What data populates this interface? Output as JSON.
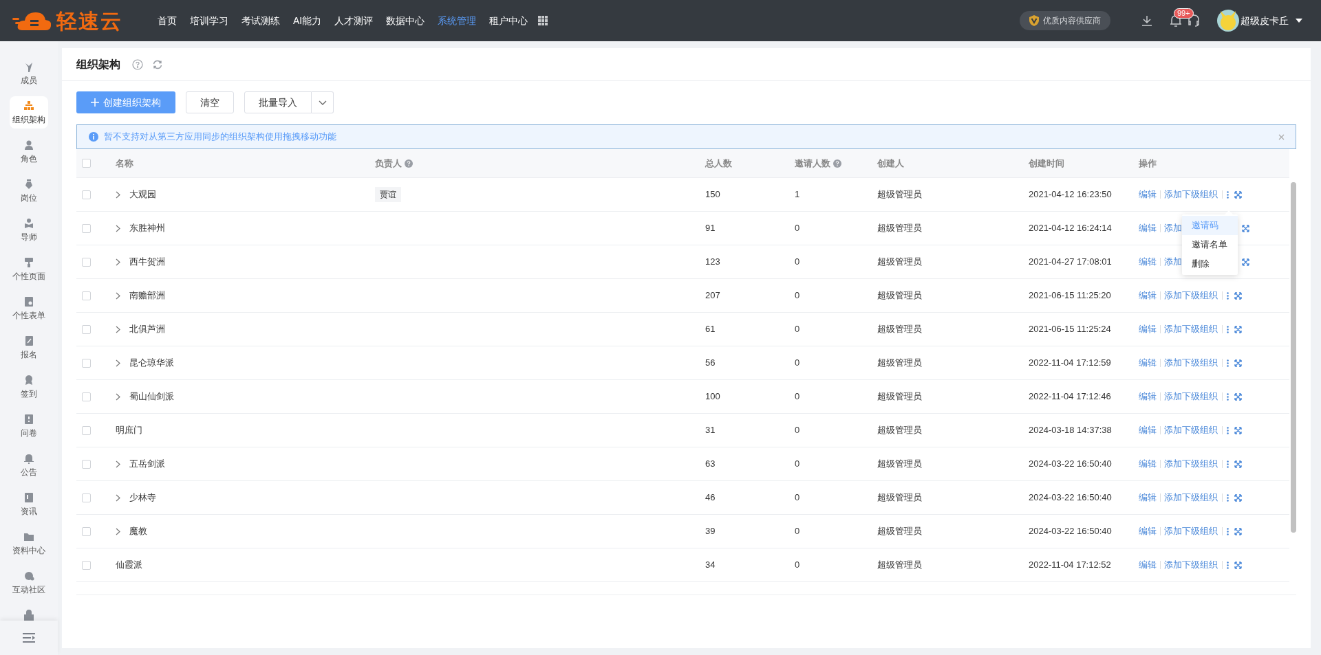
{
  "header": {
    "logo": "轻速云",
    "nav": [
      {
        "label": "首页",
        "selected": false
      },
      {
        "label": "培训学习",
        "selected": false
      },
      {
        "label": "考试测练",
        "selected": false
      },
      {
        "label": "AI能力",
        "selected": false
      },
      {
        "label": "人才测评",
        "selected": false
      },
      {
        "label": "数据中心",
        "selected": false
      },
      {
        "label": "系统管理",
        "selected": true
      },
      {
        "label": "租户中心",
        "selected": false
      }
    ],
    "vendor_badge": "优质内容供应商",
    "notification_count": "99+",
    "user": "超级皮卡丘"
  },
  "sidebar": {
    "items": [
      {
        "label": "成员",
        "selected": false
      },
      {
        "label": "组织架构",
        "selected": true
      },
      {
        "label": "角色",
        "selected": false
      },
      {
        "label": "岗位",
        "selected": false
      },
      {
        "label": "导师",
        "selected": false
      },
      {
        "label": "个性页面",
        "selected": false
      },
      {
        "label": "个性表单",
        "selected": false
      },
      {
        "label": "报名",
        "selected": false
      },
      {
        "label": "签到",
        "selected": false
      },
      {
        "label": "问卷",
        "selected": false
      },
      {
        "label": "公告",
        "selected": false
      },
      {
        "label": "资讯",
        "selected": false
      },
      {
        "label": "资料中心",
        "selected": false
      },
      {
        "label": "互动社区",
        "selected": false
      }
    ]
  },
  "page": {
    "title": "组织架构",
    "buttons": {
      "create": "创建组织架构",
      "clear": "清空",
      "import": "批量导入"
    },
    "alert": "暂不支持对从第三方应用同步的组织架构使用拖拽移动功能"
  },
  "table": {
    "select_all_checked": false,
    "columns": [
      "名称",
      "负责人",
      "总人数",
      "邀请人数",
      "创建人",
      "创建时间",
      "操作"
    ],
    "rows": [
      {
        "checked": false,
        "name": "大观园",
        "expandable": true,
        "owner": "贾谊",
        "total": "150",
        "invited": "1",
        "creator": "超级管理员",
        "created": "2021-04-12 16:23:50",
        "actions": [
          "编辑",
          "添加下级组织"
        ],
        "menu_icon": true
      },
      {
        "checked": false,
        "name": "东胜神州",
        "expandable": true,
        "total": "91",
        "invited": "0",
        "creator": "超级管理员",
        "created": "2021-04-12 16:24:14",
        "actions": [
          "编辑",
          "添加"
        ],
        "menu_icon": false
      },
      {
        "checked": false,
        "name": "西牛贺洲",
        "expandable": true,
        "total": "123",
        "invited": "0",
        "creator": "超级管理员",
        "created": "2021-04-27 17:08:01",
        "actions": [
          "编辑",
          "添加"
        ],
        "menu_icon": false
      },
      {
        "checked": false,
        "name": "南赡部洲",
        "expandable": true,
        "total": "207",
        "invited": "0",
        "creator": "超级管理员",
        "created": "2021-06-15 11:25:20",
        "actions": [
          "编辑",
          "添加下级组织"
        ],
        "menu_icon": true
      },
      {
        "checked": false,
        "name": "北俱芦洲",
        "expandable": true,
        "total": "61",
        "invited": "0",
        "creator": "超级管理员",
        "created": "2021-06-15 11:25:24",
        "actions": [
          "编辑",
          "添加下级组织"
        ],
        "menu_icon": true
      },
      {
        "checked": false,
        "name": "昆仑琼华派",
        "expandable": true,
        "total": "56",
        "invited": "0",
        "creator": "超级管理员",
        "created": "2022-11-04 17:12:59",
        "actions": [
          "编辑",
          "添加下级组织"
        ],
        "menu_icon": true
      },
      {
        "checked": false,
        "name": "蜀山仙剑派",
        "expandable": true,
        "total": "100",
        "invited": "0",
        "creator": "超级管理员",
        "created": "2022-11-04 17:12:46",
        "actions": [
          "编辑",
          "添加下级组织"
        ],
        "menu_icon": true
      },
      {
        "checked": false,
        "name": "明庶门",
        "expandable": false,
        "total": "31",
        "invited": "0",
        "creator": "超级管理员",
        "created": "2024-03-18 14:37:38",
        "actions": [
          "编辑",
          "添加下级组织"
        ],
        "menu_icon": true
      },
      {
        "checked": false,
        "name": "五岳剑派",
        "expandable": true,
        "total": "63",
        "invited": "0",
        "creator": "超级管理员",
        "created": "2024-03-22 16:50:40",
        "actions": [
          "编辑",
          "添加下级组织"
        ],
        "menu_icon": true
      },
      {
        "checked": false,
        "name": "少林寺",
        "expandable": true,
        "total": "46",
        "invited": "0",
        "creator": "超级管理员",
        "created": "2024-03-22 16:50:40",
        "actions": [
          "编辑",
          "添加下级组织"
        ],
        "menu_icon": true
      },
      {
        "checked": false,
        "name": "魔教",
        "expandable": true,
        "total": "39",
        "invited": "0",
        "creator": "超级管理员",
        "created": "2024-03-22 16:50:40",
        "actions": [
          "编辑",
          "添加下级组织"
        ],
        "menu_icon": true
      },
      {
        "checked": false,
        "name": "仙霞派",
        "expandable": false,
        "total": "34",
        "invited": "0",
        "creator": "超级管理员",
        "created": "2022-11-04 17:12:52",
        "actions": [
          "编辑",
          "添加下级组织"
        ],
        "menu_icon": true
      }
    ]
  },
  "dropdown_menu": [
    {
      "label": "邀请码",
      "selected": true
    },
    {
      "label": "邀请名单",
      "selected": false
    },
    {
      "label": "删除",
      "selected": false
    }
  ]
}
